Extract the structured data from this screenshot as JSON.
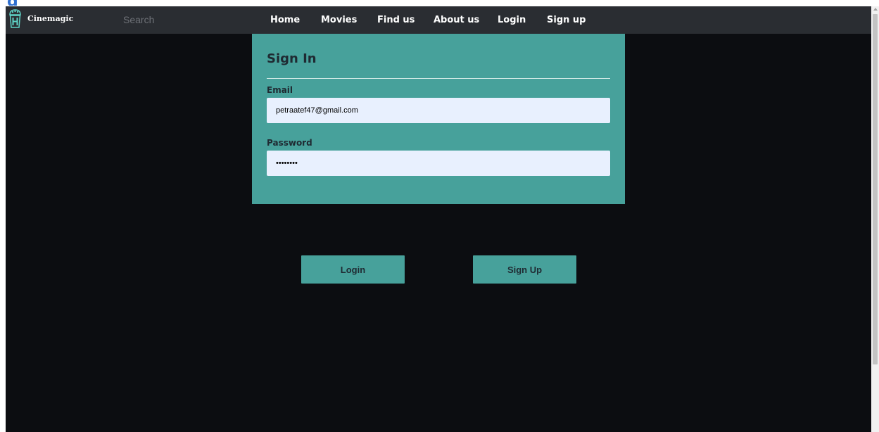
{
  "top_cut_text": "g",
  "navbar": {
    "brand": "Cinemagic",
    "logo_icon": "popcorn-box-icon",
    "search_placeholder": "Search",
    "links": [
      "Home",
      "Movies",
      "Find us",
      "About us",
      "Login",
      "Sign up"
    ]
  },
  "signin": {
    "title": "Sign In",
    "email_label": "Email",
    "email_value": "petraatef47@gmail.com",
    "password_label": "Password",
    "password_value": "••••••••"
  },
  "buttons": {
    "login": "Login",
    "signup": "Sign Up"
  },
  "colors": {
    "accent": "#47a19b",
    "page_background": "#0c0d11",
    "navbar_background": "#2a2d32",
    "input_background": "#e8f0fe"
  }
}
